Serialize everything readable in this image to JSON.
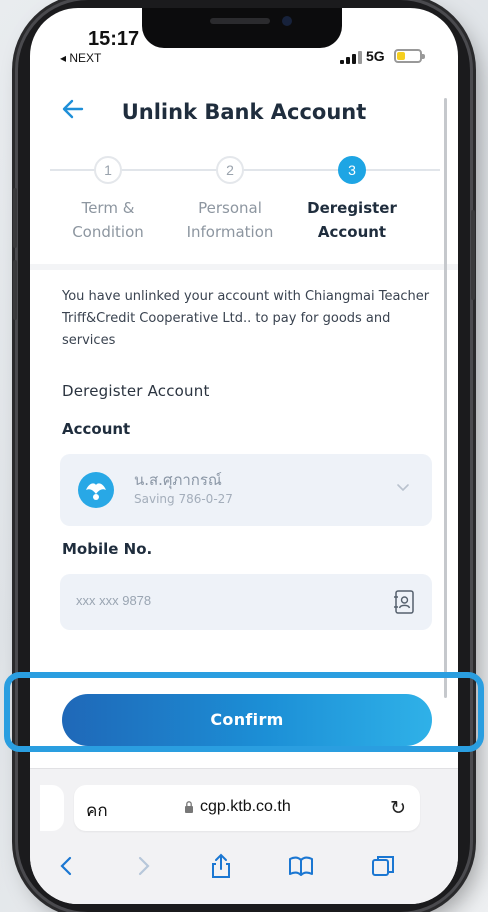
{
  "status": {
    "time": "15:17",
    "back_app": "◂ NEXT",
    "network": "5G"
  },
  "header": {
    "title": "Unlink Bank Account"
  },
  "steps": [
    {
      "num": "1",
      "label_line1": "Term &",
      "label_line2": "Condition",
      "active": false
    },
    {
      "num": "2",
      "label_line1": "Personal",
      "label_line2": "Information",
      "active": false
    },
    {
      "num": "3",
      "label_line1": "Deregister",
      "label_line2": "Account",
      "active": true
    }
  ],
  "info_text": "You have unlinked your account with Chiangmai Teacher Triff&Credit Cooperative Ltd.. to pay for goods and services",
  "section_title": "Deregister Account",
  "account": {
    "label": "Account",
    "name": "น.ส.ศุภากรณ์",
    "number": "Saving 786-0-27"
  },
  "mobile": {
    "label": "Mobile No.",
    "value": "xxx xxx 9878"
  },
  "confirm_label": "Confirm",
  "safari": {
    "aa": "คก",
    "url": "cgp.ktb.co.th",
    "reload": "↻"
  },
  "colors": {
    "accent": "#1ea5e4",
    "button_start": "#1f68b8",
    "button_end": "#2fb1e8",
    "highlight": "#2a9ee0"
  }
}
